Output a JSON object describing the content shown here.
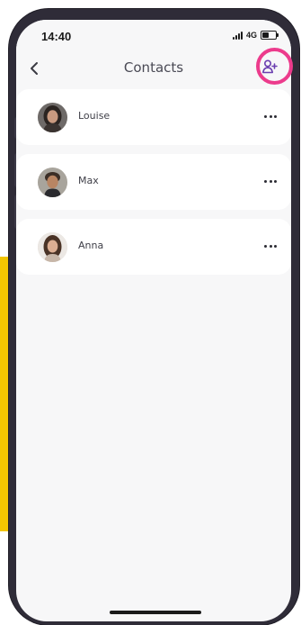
{
  "status_bar": {
    "time": "14:40",
    "network": "4G"
  },
  "header": {
    "title": "Contacts",
    "back_icon": "chevron-left-icon",
    "add_icon": "add-person-icon",
    "accent_color": "#6b3fb0",
    "highlight_color": "#ec3b8c"
  },
  "contacts": [
    {
      "name": "Louise",
      "avatar_icon": "person-photo-louise",
      "more_icon": "more-horizontal-icon"
    },
    {
      "name": "Max",
      "avatar_icon": "person-photo-max",
      "more_icon": "more-horizontal-icon"
    },
    {
      "name": "Anna",
      "avatar_icon": "person-photo-anna",
      "more_icon": "more-horizontal-icon"
    }
  ],
  "colors": {
    "background": "#f7f7f8",
    "card": "#ffffff",
    "frame": "#2f2c38",
    "side_block": "#f2c500"
  }
}
